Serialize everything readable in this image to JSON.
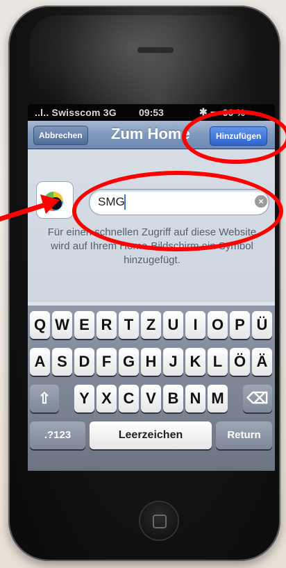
{
  "status": {
    "carrier": "..l.. Swisscom 3G",
    "time": "09:53",
    "bluetooth": "✱",
    "battery": "━╸90 %"
  },
  "navbar": {
    "cancel": "Abbrechen",
    "title": "Zum Home",
    "add": "Hinzufügen"
  },
  "field": {
    "value": "SMG",
    "clear": "×"
  },
  "hint": "Für einen schnellen Zugriff auf diese Website wird auf Ihrem Home-Bildschirm ein Symbol hinzugefügt.",
  "keyboard": {
    "row1": [
      "Q",
      "W",
      "E",
      "R",
      "T",
      "Z",
      "U",
      "I",
      "O",
      "P",
      "Ü"
    ],
    "row2": [
      "A",
      "S",
      "D",
      "F",
      "G",
      "H",
      "J",
      "K",
      "L",
      "Ö",
      "Ä"
    ],
    "row3": [
      "Y",
      "X",
      "C",
      "V",
      "B",
      "N",
      "M"
    ],
    "shift": "⇧",
    "backspace": "⌫",
    "numbers": ".?123",
    "space": "Leerzeichen",
    "return": "Return"
  },
  "annotation_color": "#ff0000"
}
